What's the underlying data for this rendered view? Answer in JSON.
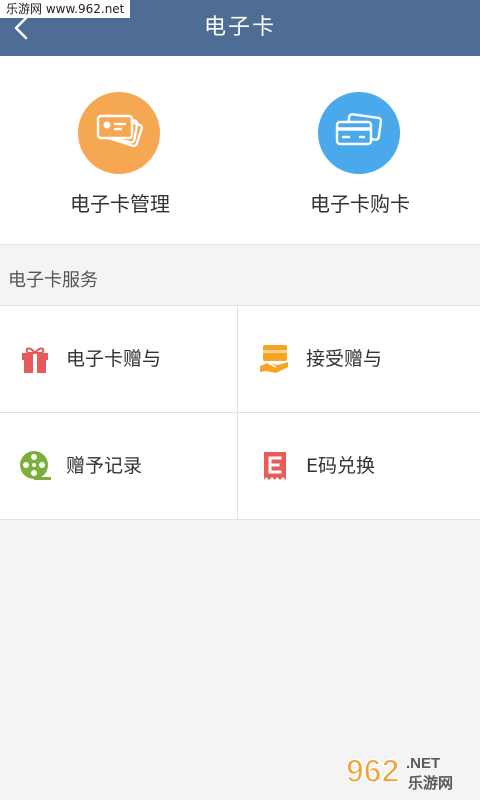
{
  "watermark_top": "乐游网 www.962.net",
  "header": {
    "title": "电子卡"
  },
  "top_actions": [
    {
      "label": "电子卡管理",
      "color": "#f6a751",
      "icon": "cards-stack-icon"
    },
    {
      "label": "电子卡购卡",
      "color": "#4aa9ea",
      "icon": "card-purchase-icon"
    }
  ],
  "section": {
    "title": "电子卡服务"
  },
  "services": [
    {
      "label": "电子卡赠与",
      "icon": "gift-icon",
      "color": "#e75a5a"
    },
    {
      "label": "接受赠与",
      "icon": "receive-card-icon",
      "color": "#f4a523"
    },
    {
      "label": "赠予记录",
      "icon": "film-reel-icon",
      "color": "#7bae3b"
    },
    {
      "label": "E码兑换",
      "icon": "e-code-ticket-icon",
      "color": "#ea5b5b"
    }
  ],
  "watermark_bottom": {
    "digits": "962",
    "suffix": ".NET",
    "site": "乐游网"
  }
}
